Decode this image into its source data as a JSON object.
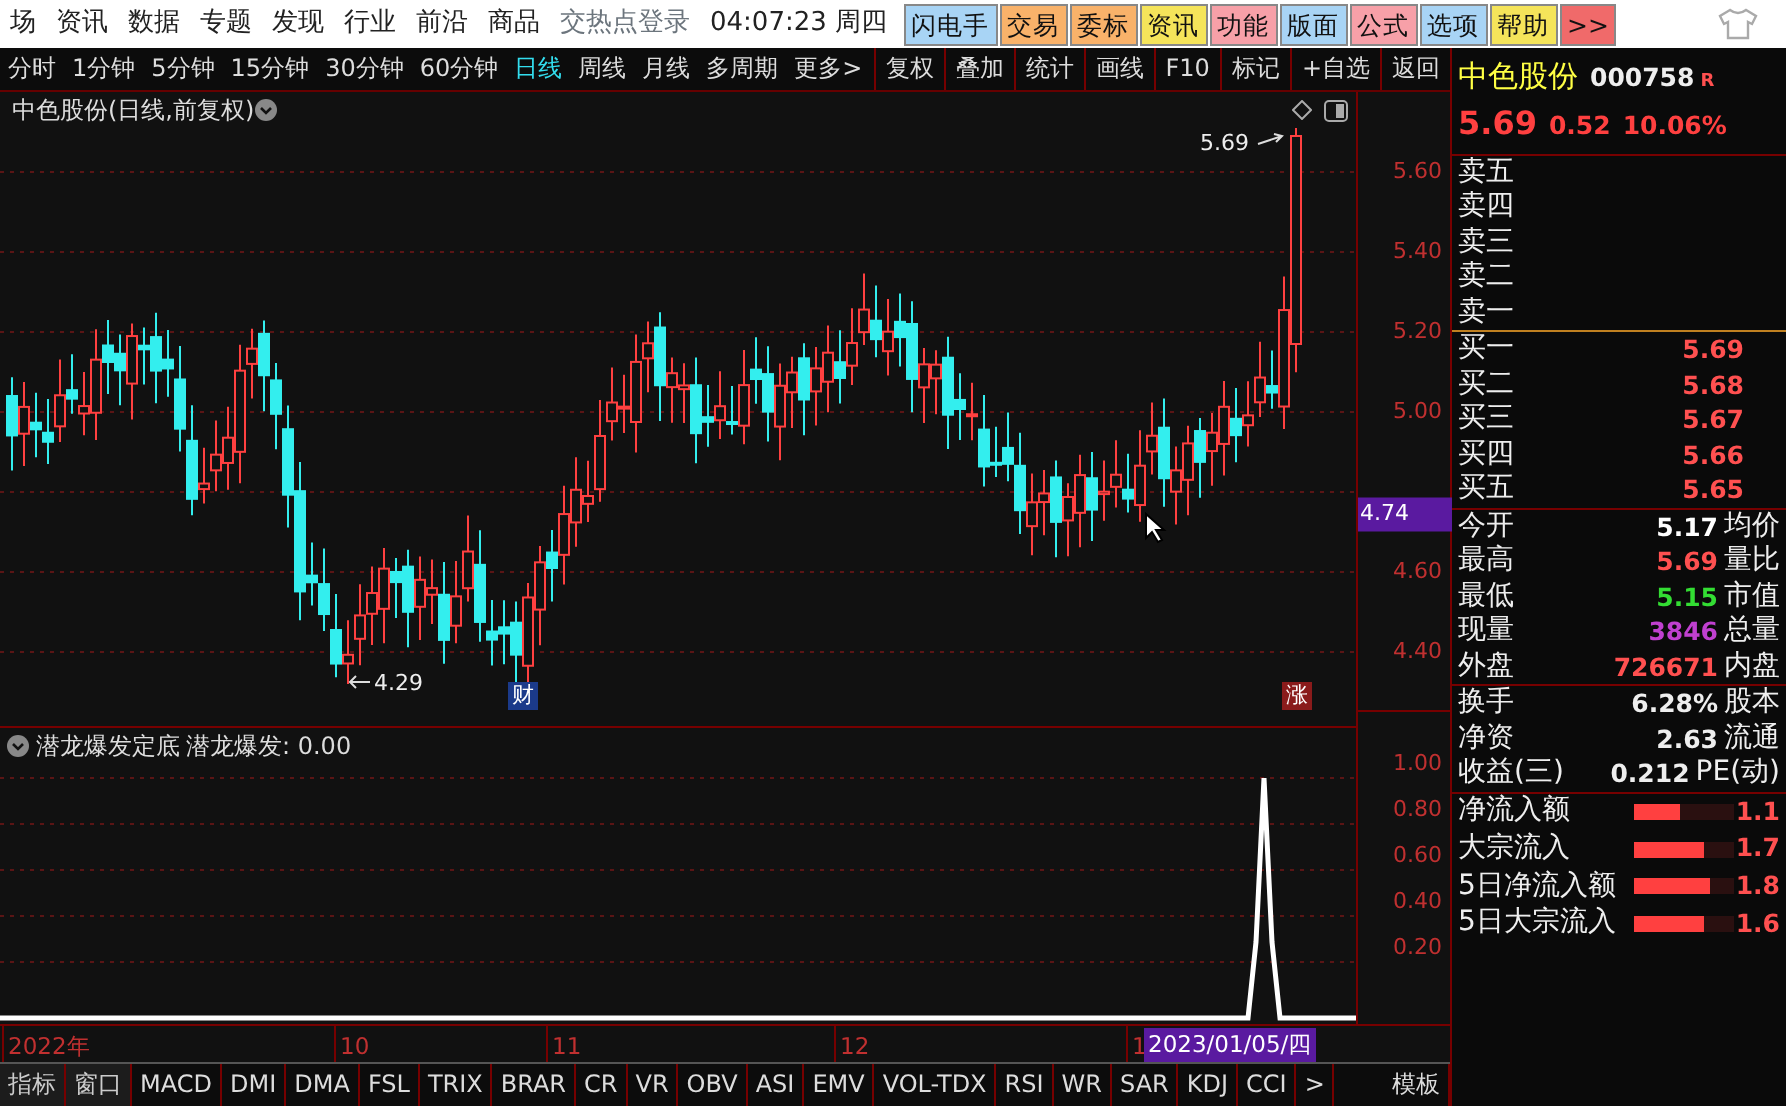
{
  "menu_bar": {
    "items": [
      "场",
      "资讯",
      "数据",
      "专题",
      "发现",
      "行业",
      "前沿",
      "商品"
    ],
    "hot_text": "交热点登录",
    "clock": "04:07:23 周四",
    "buttons": [
      {
        "label": "闪电手",
        "color": "#a8d4f5"
      },
      {
        "label": "交易",
        "color": "#f9b26a"
      },
      {
        "label": "委标",
        "color": "#f9b26a"
      },
      {
        "label": "资讯",
        "color": "#f5e45a"
      },
      {
        "label": "功能",
        "color": "#f7a0a8"
      },
      {
        "label": "版面",
        "color": "#a8d4f5"
      },
      {
        "label": "公式",
        "color": "#f7a0a8"
      },
      {
        "label": "选项",
        "color": "#a8d4f5"
      },
      {
        "label": "帮助",
        "color": "#f5e45a"
      },
      {
        "label": ">>",
        "color": "#f06a6a"
      }
    ]
  },
  "period_bar": {
    "periods": [
      {
        "label": "分时",
        "selected": false
      },
      {
        "label": "1分钟",
        "selected": false
      },
      {
        "label": "5分钟",
        "selected": false
      },
      {
        "label": "15分钟",
        "selected": false
      },
      {
        "label": "30分钟",
        "selected": false
      },
      {
        "label": "60分钟",
        "selected": false
      },
      {
        "label": "日线",
        "selected": true
      },
      {
        "label": "周线",
        "selected": false
      },
      {
        "label": "月线",
        "selected": false
      },
      {
        "label": "多周期",
        "selected": false
      },
      {
        "label": "更多>",
        "selected": false
      }
    ],
    "tools": [
      "复权",
      "叠加",
      "统计",
      "画线",
      "F10",
      "标记",
      "+自选",
      "返回"
    ]
  },
  "chart": {
    "title": "中色股份(日线,前复权)",
    "y_ticks": [
      "5.60",
      "5.40",
      "5.20",
      "5.00",
      "4.60",
      "4.40"
    ],
    "current_price_tag": "4.74",
    "high_label": "5.69",
    "low_label": "4.29",
    "event_badges": [
      {
        "label": "财",
        "kind": "finance"
      },
      {
        "label": "涨",
        "kind": "limit_up"
      }
    ]
  },
  "indicator": {
    "name": "潜龙爆发定底",
    "reading": "潜龙爆发: 0.00",
    "y_ticks": [
      "1.00",
      "0.80",
      "0.60",
      "0.40",
      "0.20"
    ]
  },
  "date_axis": {
    "labels": [
      "2022年",
      "10",
      "11",
      "12",
      "1"
    ],
    "cursor_date": "2023/01/05/四"
  },
  "indicator_tabs": [
    {
      "label": "指标",
      "kind": "menu"
    },
    {
      "label": "窗口",
      "kind": "menu"
    },
    {
      "label": "MACD",
      "kind": "tab"
    },
    {
      "label": "DMI",
      "kind": "tab"
    },
    {
      "label": "DMA",
      "kind": "tab"
    },
    {
      "label": "FSL",
      "kind": "tab"
    },
    {
      "label": "TRIX",
      "kind": "tab"
    },
    {
      "label": "BRAR",
      "kind": "tab"
    },
    {
      "label": "CR",
      "kind": "tab"
    },
    {
      "label": "VR",
      "kind": "tab"
    },
    {
      "label": "OBV",
      "kind": "tab"
    },
    {
      "label": "ASI",
      "kind": "tab"
    },
    {
      "label": "EMV",
      "kind": "tab"
    },
    {
      "label": "VOL-TDX",
      "kind": "tab"
    },
    {
      "label": "RSI",
      "kind": "tab"
    },
    {
      "label": "WR",
      "kind": "tab"
    },
    {
      "label": "SAR",
      "kind": "tab"
    },
    {
      "label": "KDJ",
      "kind": "tab"
    },
    {
      "label": "CCI",
      "kind": "tab"
    },
    {
      "label": ">",
      "kind": "tab"
    }
  ],
  "template_button": "模板",
  "quote_panel": {
    "name": "中色股份",
    "code": "000758",
    "tag": "R",
    "price": "5.69",
    "change": "0.52",
    "change_pct": "10.06%",
    "sells": [
      {
        "label": "卖五"
      },
      {
        "label": "卖四"
      },
      {
        "label": "卖三"
      },
      {
        "label": "卖二"
      },
      {
        "label": "卖一"
      }
    ],
    "buys": [
      {
        "label": "买一",
        "price": "5.69"
      },
      {
        "label": "买二",
        "price": "5.68"
      },
      {
        "label": "买三",
        "price": "5.67"
      },
      {
        "label": "买四",
        "price": "5.66"
      },
      {
        "label": "买五",
        "price": "5.65"
      }
    ],
    "stats": [
      {
        "label": "今开",
        "value": "5.17",
        "color": "#ffffff",
        "label2": "均价"
      },
      {
        "label": "最高",
        "value": "5.69",
        "color": "#ff5050",
        "label2": "量比"
      },
      {
        "label": "最低",
        "value": "5.15",
        "color": "#33dd33",
        "label2": "市值"
      },
      {
        "label": "现量",
        "value": "3846",
        "color": "#c040d0",
        "label2": "总量"
      },
      {
        "label": "外盘",
        "value": "726671",
        "color": "#ff5050",
        "label2": "内盘"
      }
    ],
    "finance": [
      {
        "label": "换手",
        "value": "6.28%",
        "label2": "股本"
      },
      {
        "label": "净资",
        "value": "2.63",
        "label2": "流通"
      },
      {
        "label": "收益(三)",
        "value": "0.212",
        "label2": "PE(动)"
      }
    ],
    "flows": [
      {
        "label": "净流入额",
        "level": 0.45,
        "value": "1.1"
      },
      {
        "label": "大宗流入",
        "level": 0.7,
        "value": "1.7"
      },
      {
        "label": "5日净流入额",
        "level": 0.75,
        "value": "1.8"
      },
      {
        "label": "5日大宗流入",
        "level": 0.7,
        "value": "1.6"
      }
    ]
  }
}
